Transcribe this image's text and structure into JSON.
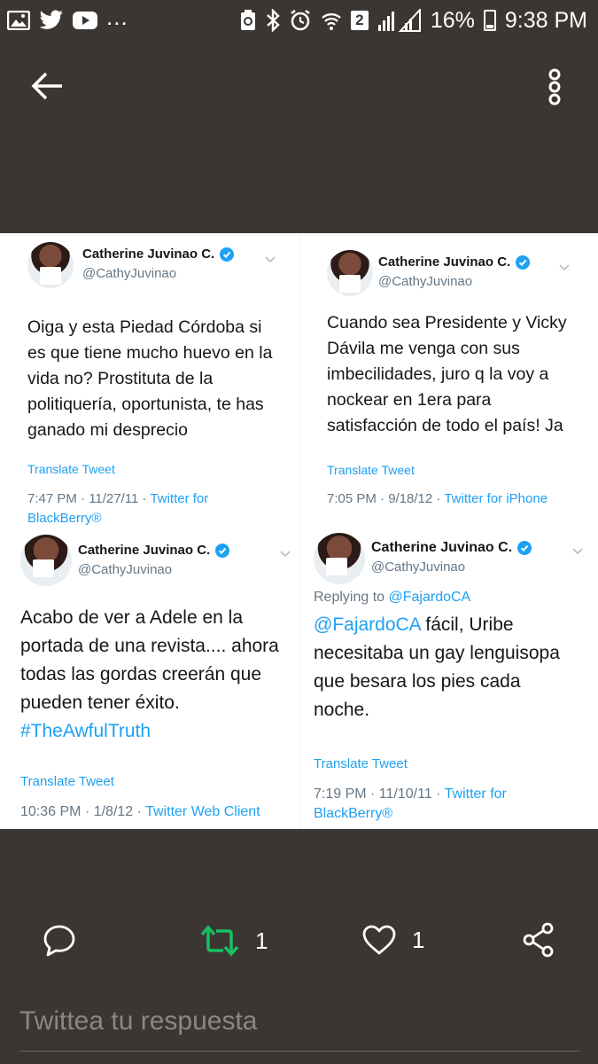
{
  "status_bar": {
    "more_indicator": "...",
    "sim_badge": "2",
    "battery_percent": "16%",
    "time": "9:38 PM"
  },
  "app_bar": {
    "back_icon": "arrow-left-icon",
    "overflow_icon": "vertical-dots-icon"
  },
  "tweets": [
    {
      "name": "Catherine Juvinao C.",
      "handle": "@CathyJuvinao",
      "text": "Oiga y esta Piedad Córdoba si es que tiene mucho huevo en la vida no? Prostituta de la politiquería, oportunista, te has ganado mi desprecio",
      "translate": "Translate Tweet",
      "time": "7:47 PM · 11/27/11 · ",
      "source": "Twitter for BlackBerry®"
    },
    {
      "name": "Catherine Juvinao C.",
      "handle": "@CathyJuvinao",
      "text": "Cuando sea Presidente y Vicky Dávila me venga con sus imbecilidades, juro q la voy a nockear en 1era para satisfacción de todo el país! Ja",
      "translate": "Translate Tweet",
      "time": "7:05 PM · 9/18/12 · ",
      "source": "Twitter for iPhone"
    },
    {
      "name": "Catherine Juvinao C.",
      "handle": "@CathyJuvinao",
      "text": "Acabo de ver a Adele en la portada de una revista.... ahora todas las gordas creerán que pueden tener éxito.",
      "hashtag": "#TheAwfulTruth",
      "translate": "Translate Tweet",
      "time": "10:36 PM · 1/8/12 · ",
      "source": "Twitter Web Client"
    },
    {
      "name": "Catherine Juvinao C.",
      "handle": "@CathyJuvinao",
      "replying_label": "Replying to ",
      "replying_to": "@FajardoCA",
      "mention": "@FajardoCA",
      "text": " fácil, Uribe necesitaba un gay lenguisopa que besara los pies cada noche.",
      "translate": "Translate Tweet",
      "time": "7:19 PM · 11/10/11 · ",
      "source": "Twitter for BlackBerry®"
    }
  ],
  "actions": {
    "reply_icon": "speech-bubble-icon",
    "retweet_icon": "retweet-icon",
    "retweet_count": "1",
    "like_icon": "heart-icon",
    "like_count": "1",
    "share_icon": "share-icon",
    "retweet_color": "#17bf63"
  },
  "reply_box": {
    "placeholder": "Twittea tu respuesta"
  }
}
